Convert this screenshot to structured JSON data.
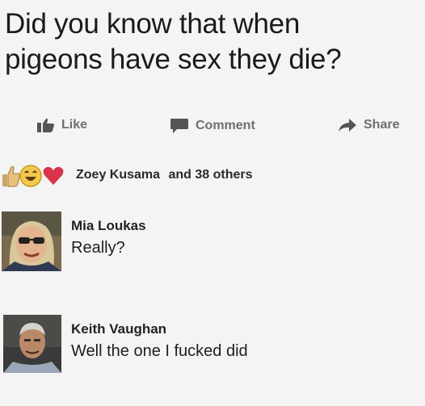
{
  "post": {
    "line1": "Did you know that when",
    "line2": "pigeons have sex they die?"
  },
  "actions": {
    "like_label": "Like",
    "comment_label": "Comment",
    "share_label": "Share",
    "icons": [
      "thumbs-up-icon",
      "comment-bubble-icon",
      "share-arrow-icon"
    ]
  },
  "reactions": {
    "icons": [
      "thumbs-up-icon",
      "laughing-face-icon",
      "heart-icon"
    ],
    "name": "Zoey Kusama",
    "others": "and 38 others"
  },
  "comments": [
    {
      "author": "Mia Loukas",
      "text": "Really?"
    },
    {
      "author": "Keith Vaughan",
      "text": "Well the one I fucked did"
    }
  ],
  "colors": {
    "background": "#f4f4f4",
    "action_gray": "#6f6f6f",
    "heart": "#d9344a",
    "laugh": "#f2c94c"
  }
}
